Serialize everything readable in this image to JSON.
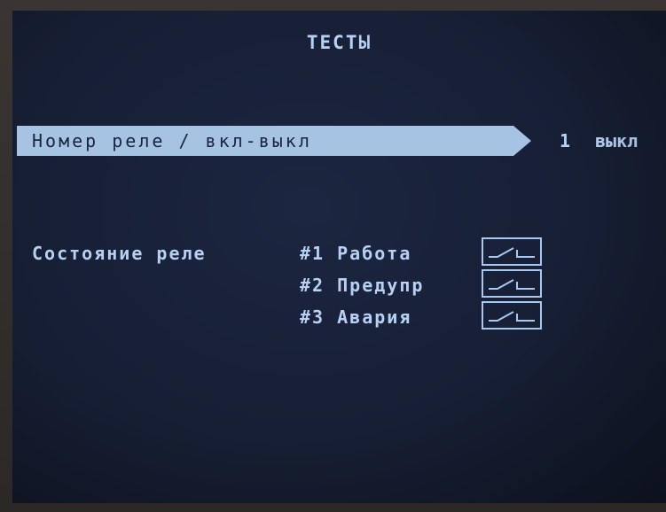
{
  "screen": {
    "title": "ТЕСТЫ"
  },
  "menu_row": {
    "label": "Номер реле / вкл-выкл",
    "relay_number": "1",
    "state": "выкл"
  },
  "relay_status": {
    "label": "Состояние реле",
    "items": [
      {
        "number": "#1",
        "name": "Работа",
        "icon": "relay-open-switch-icon"
      },
      {
        "number": "#2",
        "name": "Предупр",
        "icon": "relay-open-switch-icon"
      },
      {
        "number": "#3",
        "name": "Авария",
        "icon": "relay-open-switch-icon"
      }
    ]
  },
  "colors": {
    "screen_bg": "#172036",
    "text": "#b7d1f5",
    "highlight": "#a7c3e3"
  }
}
